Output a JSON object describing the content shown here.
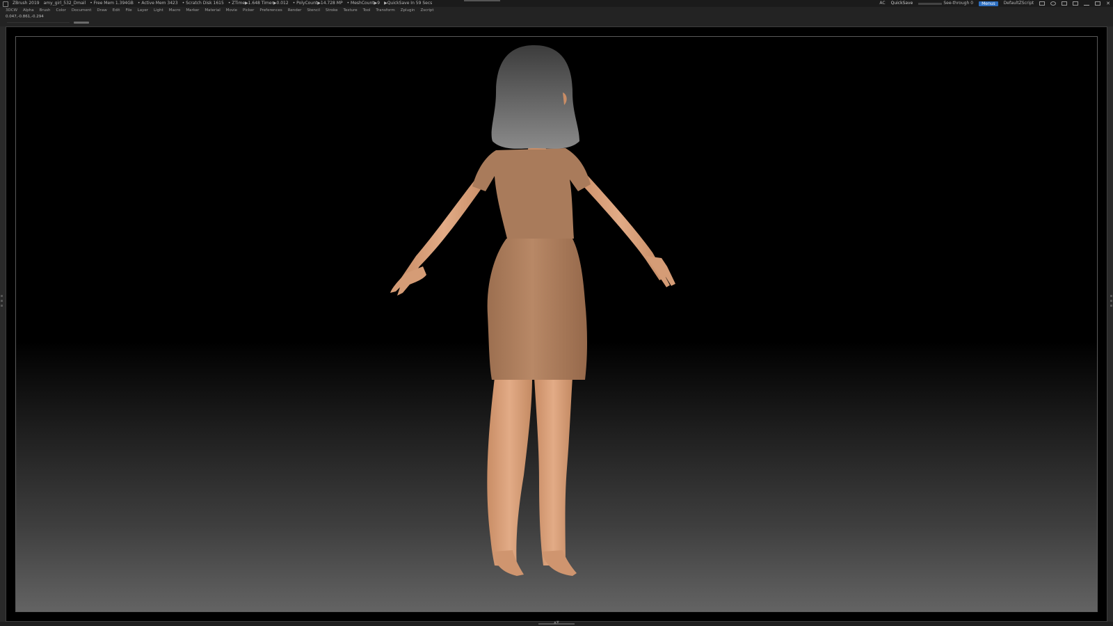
{
  "titlebar": {
    "app": "ZBrush 2019",
    "document": "amy_girl_532_Dmail",
    "free_mem": "• Free Mem 1.394GB",
    "active_mem": "• Active Mem 3423",
    "scratch_disk": "• Scratch Disk 1615",
    "ztime": "• ZTime▶1.648 Timer▶0.012",
    "polycount": "• PolyCount▶14.728 MP",
    "meshcount": "• MeshCount▶9",
    "quicksave_status": "▶QuickSave In 59 Secs",
    "ac": "AC",
    "quicksave_label": "QuickSave",
    "see_through_label": "See-through",
    "see_through_value": "0",
    "see_through_fraction": 0,
    "menus_label": "Menus",
    "script_label": "DefaultZScript"
  },
  "menubar": {
    "items": [
      "3DCW",
      "Alpha",
      "Brush",
      "Color",
      "Document",
      "Draw",
      "Edit",
      "File",
      "Layer",
      "Light",
      "Macro",
      "Marker",
      "Material",
      "Movie",
      "Picker",
      "Preferences",
      "Render",
      "Stencil",
      "Stroke",
      "Texture",
      "Tool",
      "Transform",
      "Zplugin",
      "Zscript"
    ]
  },
  "infobar": {
    "coords": "0.047,-0.861,-0.294"
  },
  "colors": {
    "accent": "#2c6ec0",
    "see_through_fill": "#46a54b",
    "skin": "#d9a07a",
    "dress": "#a97b5b",
    "hair": "#6a6a6a"
  },
  "icons": [
    "window-tile-icon",
    "gear-icon",
    "layout-icon",
    "lock-icon",
    "minimize-icon",
    "maximize-icon",
    "close-icon"
  ]
}
